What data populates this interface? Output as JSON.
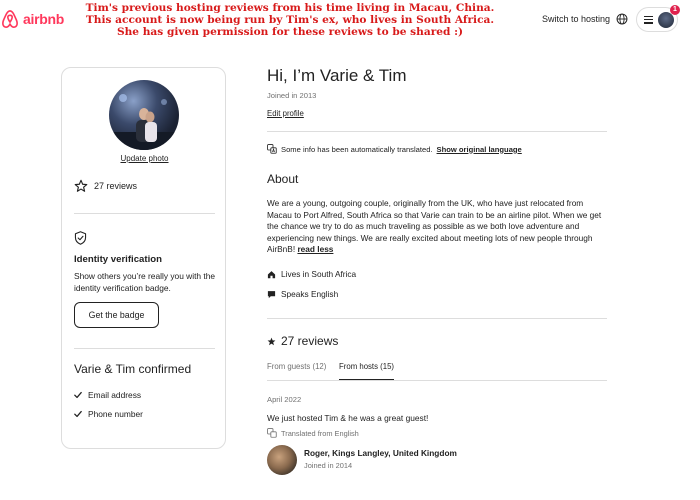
{
  "header": {
    "brand": "airbnb",
    "brand_color": "#ff385c",
    "banner_lines": [
      "Tim's previous hosting reviews from his time living in Macau, China.",
      "This account is now being run by Tim's ex, who lives in South Africa.",
      "She has given permission for these reviews to be shared :)"
    ],
    "banner_color": "#d81a1a",
    "switch_to_hosting": "Switch to hosting",
    "globe_icon": "globe-icon",
    "menu_icon": "hamburger-icon",
    "notification_count": "1"
  },
  "sidebar": {
    "update_photo": "Update photo",
    "reviews_count_label": "27 reviews",
    "identity_title": "Identity verification",
    "identity_text": "Show others you’re really you with the identity verification badge.",
    "get_badge": "Get the badge",
    "confirmed_title": "Varie & Tim confirmed",
    "confirmed_items": [
      "Email address",
      "Phone number"
    ]
  },
  "main": {
    "title": "Hi, I’m Varie & Tim",
    "joined": "Joined in 2013",
    "edit_profile": "Edit profile",
    "translation_note": "Some info has been automatically translated.",
    "show_original": "Show original language",
    "about_heading": "About",
    "about_text": "We are a young, outgoing couple, originally from the UK, who have just relocated from Macau to Port Alfred, South Africa so that Varie can train to be an airline pilot. When we get the chance we try to do as much traveling as possible as we both love adventure and experiencing new things. We are really excited about meeting lots of new people through AirBnB! ",
    "read_less": "read less",
    "lives_in": "Lives in South Africa",
    "speaks": "Speaks English",
    "reviews_heading": "27 reviews",
    "tabs": [
      "From guests (12)",
      "From hosts (15)"
    ],
    "active_tab": "From hosts (15)",
    "review": {
      "date": "April 2022",
      "text": "We just hosted Tim & he was a great guest!",
      "translated": "Translated from English",
      "reviewer_name": "Roger, Kings Langley, United Kingdom",
      "reviewer_joined": "Joined in 2014"
    }
  }
}
